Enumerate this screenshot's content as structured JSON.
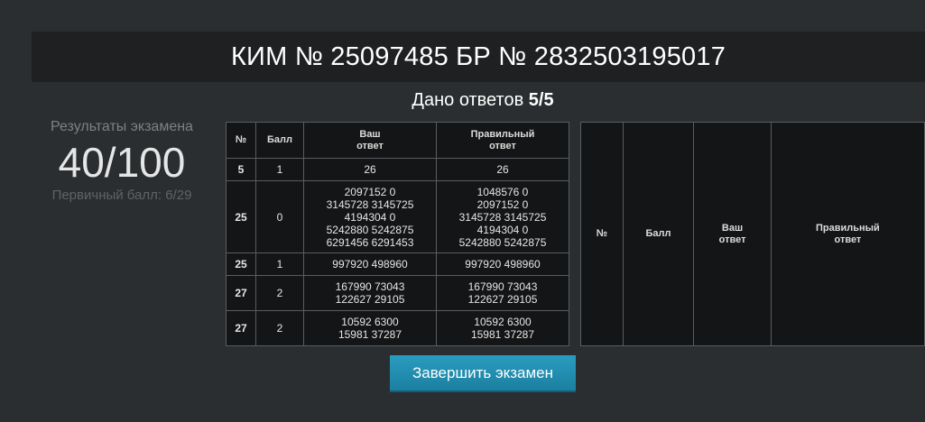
{
  "header": {
    "title": "КИМ № 25097485 БР № 2832503195017"
  },
  "answers_given": {
    "prefix": "Дано ответов",
    "value": "5/5"
  },
  "results": {
    "label": "Результаты экзамена",
    "score": "40/100",
    "primary": "Первичный балл: 6/29"
  },
  "table": {
    "headers": {
      "num": "№",
      "score": "Балл",
      "answer_line1": "Ваш",
      "answer_line2": "ответ",
      "correct_line1": "Правильный",
      "correct_line2": "ответ"
    },
    "rows": [
      {
        "num": "5",
        "score": "1",
        "answer": [
          "26"
        ],
        "correct": [
          "26"
        ]
      },
      {
        "num": "25",
        "score": "0",
        "answer": [
          "2097152 0",
          "3145728 3145725",
          "4194304 0",
          "5242880 5242875",
          "6291456 6291453"
        ],
        "correct": [
          "1048576 0",
          "2097152 0",
          "3145728 3145725",
          "4194304 0",
          "5242880 5242875"
        ]
      },
      {
        "num": "25",
        "score": "1",
        "answer": [
          "997920 498960"
        ],
        "correct": [
          "997920 498960"
        ]
      },
      {
        "num": "27",
        "score": "2",
        "answer": [
          "167990 73043",
          "122627 29105"
        ],
        "correct": [
          "167990 73043",
          "122627 29105"
        ]
      },
      {
        "num": "27",
        "score": "2",
        "answer": [
          "10592 6300",
          "15981 37287"
        ],
        "correct": [
          "10592 6300",
          "15981 37287"
        ]
      }
    ]
  },
  "empty_table": {
    "headers": {
      "num": "№",
      "score": "Балл",
      "answer_line1": "Ваш",
      "answer_line2": "ответ",
      "correct_line1": "Правильный",
      "correct_line2": "ответ"
    }
  },
  "finish_button": {
    "label": "Завершить экзамен"
  },
  "colors": {
    "background": "#2b2e30",
    "header_bar": "#1e2022",
    "table_bg": "#141516",
    "task_number": "#5aa9e6",
    "button": "#1f8fb3"
  }
}
